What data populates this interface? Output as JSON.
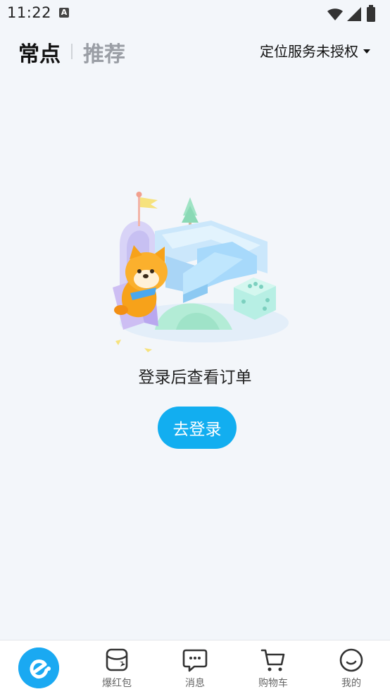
{
  "status_bar": {
    "time": "11:22",
    "notification_icon": "a-icon",
    "icons": [
      "wifi-icon",
      "signal-icon",
      "battery-icon"
    ]
  },
  "header": {
    "tab_active": "常点",
    "tab_inactive": "推荐",
    "location": "定位服务未授权"
  },
  "empty_state": {
    "illustration": "shiba-dog-playground-illustration",
    "message": "登录后查看订单",
    "login_button": "去登录"
  },
  "bottom_nav": {
    "items": [
      {
        "label": "",
        "icon": "eleme-logo-icon"
      },
      {
        "label": "爆红包",
        "icon": "red-packet-icon"
      },
      {
        "label": "消息",
        "icon": "message-icon"
      },
      {
        "label": "购物车",
        "icon": "cart-icon"
      },
      {
        "label": "我的",
        "icon": "profile-icon"
      }
    ]
  },
  "colors": {
    "accent": "#12aef0",
    "background": "#f3f6fa",
    "inactive_tab": "#9a9ea5"
  }
}
